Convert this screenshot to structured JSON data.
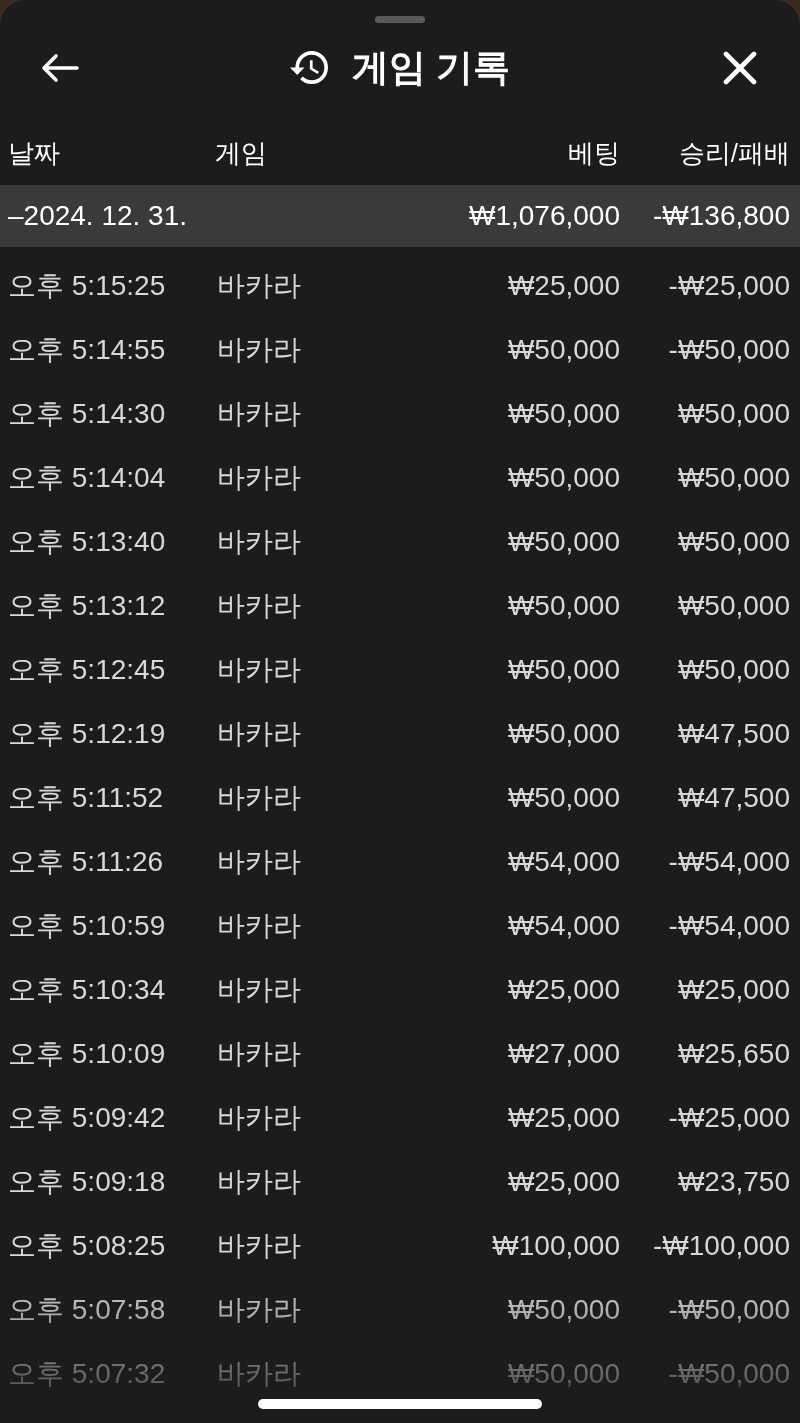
{
  "header": {
    "title": "게임 기록"
  },
  "table": {
    "columns": [
      "날짜",
      "게임",
      "베팅",
      "승리/패배"
    ],
    "group": {
      "date": "–2024. 12. 31.",
      "bet": "₩1,076,000",
      "result": "-₩136,800"
    },
    "rows": [
      {
        "time": "오후 5:15:25",
        "game": "바카라",
        "bet": "₩25,000",
        "result": "-₩25,000"
      },
      {
        "time": "오후 5:14:55",
        "game": "바카라",
        "bet": "₩50,000",
        "result": "-₩50,000"
      },
      {
        "time": "오후 5:14:30",
        "game": "바카라",
        "bet": "₩50,000",
        "result": "₩50,000"
      },
      {
        "time": "오후 5:14:04",
        "game": "바카라",
        "bet": "₩50,000",
        "result": "₩50,000"
      },
      {
        "time": "오후 5:13:40",
        "game": "바카라",
        "bet": "₩50,000",
        "result": "₩50,000"
      },
      {
        "time": "오후 5:13:12",
        "game": "바카라",
        "bet": "₩50,000",
        "result": "₩50,000"
      },
      {
        "time": "오후 5:12:45",
        "game": "바카라",
        "bet": "₩50,000",
        "result": "₩50,000"
      },
      {
        "time": "오후 5:12:19",
        "game": "바카라",
        "bet": "₩50,000",
        "result": "₩47,500"
      },
      {
        "time": "오후 5:11:52",
        "game": "바카라",
        "bet": "₩50,000",
        "result": "₩47,500"
      },
      {
        "time": "오후 5:11:26",
        "game": "바카라",
        "bet": "₩54,000",
        "result": "-₩54,000"
      },
      {
        "time": "오후 5:10:59",
        "game": "바카라",
        "bet": "₩54,000",
        "result": "-₩54,000"
      },
      {
        "time": "오후 5:10:34",
        "game": "바카라",
        "bet": "₩25,000",
        "result": "₩25,000"
      },
      {
        "time": "오후 5:10:09",
        "game": "바카라",
        "bet": "₩27,000",
        "result": "₩25,650"
      },
      {
        "time": "오후 5:09:42",
        "game": "바카라",
        "bet": "₩25,000",
        "result": "-₩25,000"
      },
      {
        "time": "오후 5:09:18",
        "game": "바카라",
        "bet": "₩25,000",
        "result": "₩23,750"
      },
      {
        "time": "오후 5:08:25",
        "game": "바카라",
        "bet": "₩100,000",
        "result": "-₩100,000"
      },
      {
        "time": "오후 5:07:58",
        "game": "바카라",
        "bet": "₩50,000",
        "result": "-₩50,000"
      },
      {
        "time": "오후 5:07:32",
        "game": "바카라",
        "bet": "₩50,000",
        "result": "-₩50,000"
      }
    ]
  }
}
